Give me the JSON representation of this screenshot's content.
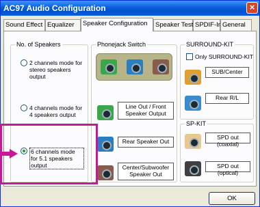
{
  "window": {
    "title": "AC97 Audio Configuration",
    "close_glyph": "×"
  },
  "tabs": [
    {
      "label": "Sound Effect"
    },
    {
      "label": "Equalizer"
    },
    {
      "label": "Speaker Configuration",
      "active": true
    },
    {
      "label": "Speaker Test"
    },
    {
      "label": "SPDIF-In"
    },
    {
      "label": "General"
    }
  ],
  "speakers_group": {
    "title": "No. of Speakers",
    "options": [
      {
        "text": "2 channels mode for stereo speakers output",
        "checked": false
      },
      {
        "text": "4 channels mode for 4 speakers output",
        "checked": false
      },
      {
        "text": "6 channels mode for 5.1 speakers output",
        "checked": true
      }
    ]
  },
  "phonejack_group": {
    "title": "Phonejack Switch",
    "jacks": [
      {
        "label": "Line Out / Front Speaker Output",
        "color": "#3aa84a"
      },
      {
        "label": "Rear Speaker Out",
        "color": "#2a7fc0"
      },
      {
        "label": "Center/Subwoofer Speaker Out",
        "color": "#8a5a4a"
      }
    ]
  },
  "surround_group": {
    "title": "SURROUND-KIT",
    "only_label": "Only SURROUND-KIT",
    "items": [
      {
        "label": "SUB/Center",
        "color": "#e0a030"
      },
      {
        "label": "Rear R/L",
        "color": "#3a8ad0"
      }
    ]
  },
  "spkit_group": {
    "title": "SP-KIT",
    "items": [
      {
        "label": "SPD out (coaxial)",
        "color": "#e8c890"
      },
      {
        "label": "SPD out (optical)",
        "color": "#404040"
      }
    ]
  },
  "ok_label": "OK",
  "highlight_color": "#c6189a"
}
